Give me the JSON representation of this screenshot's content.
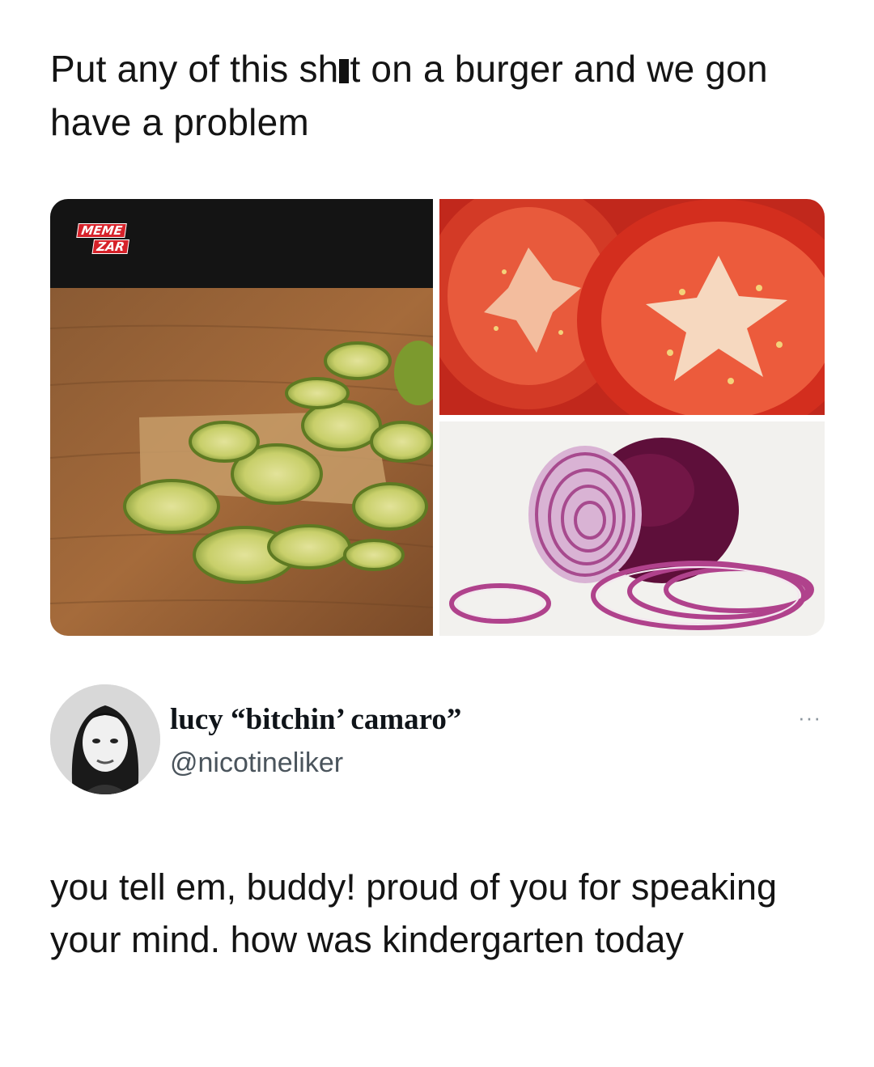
{
  "quoted_post": {
    "text_before_redaction": "Put any of this sh",
    "text_after_redaction": "t on a burger and we gon have a problem"
  },
  "collage": {
    "watermark_line1": "MEME",
    "watermark_line2": "ZAR",
    "images": [
      "pickles-photo",
      "tomato-slices-photo",
      "red-onion-photo"
    ]
  },
  "reply": {
    "display_name": "lucy “bitchin’ camaro”",
    "handle": "@nicotineliker",
    "more_label": "···",
    "text": "you tell em, buddy! proud of you for speaking your mind. how was kindergarten today"
  },
  "colors": {
    "text": "#141414",
    "handle": "#4a545c",
    "watermark_red": "#d6222a"
  }
}
